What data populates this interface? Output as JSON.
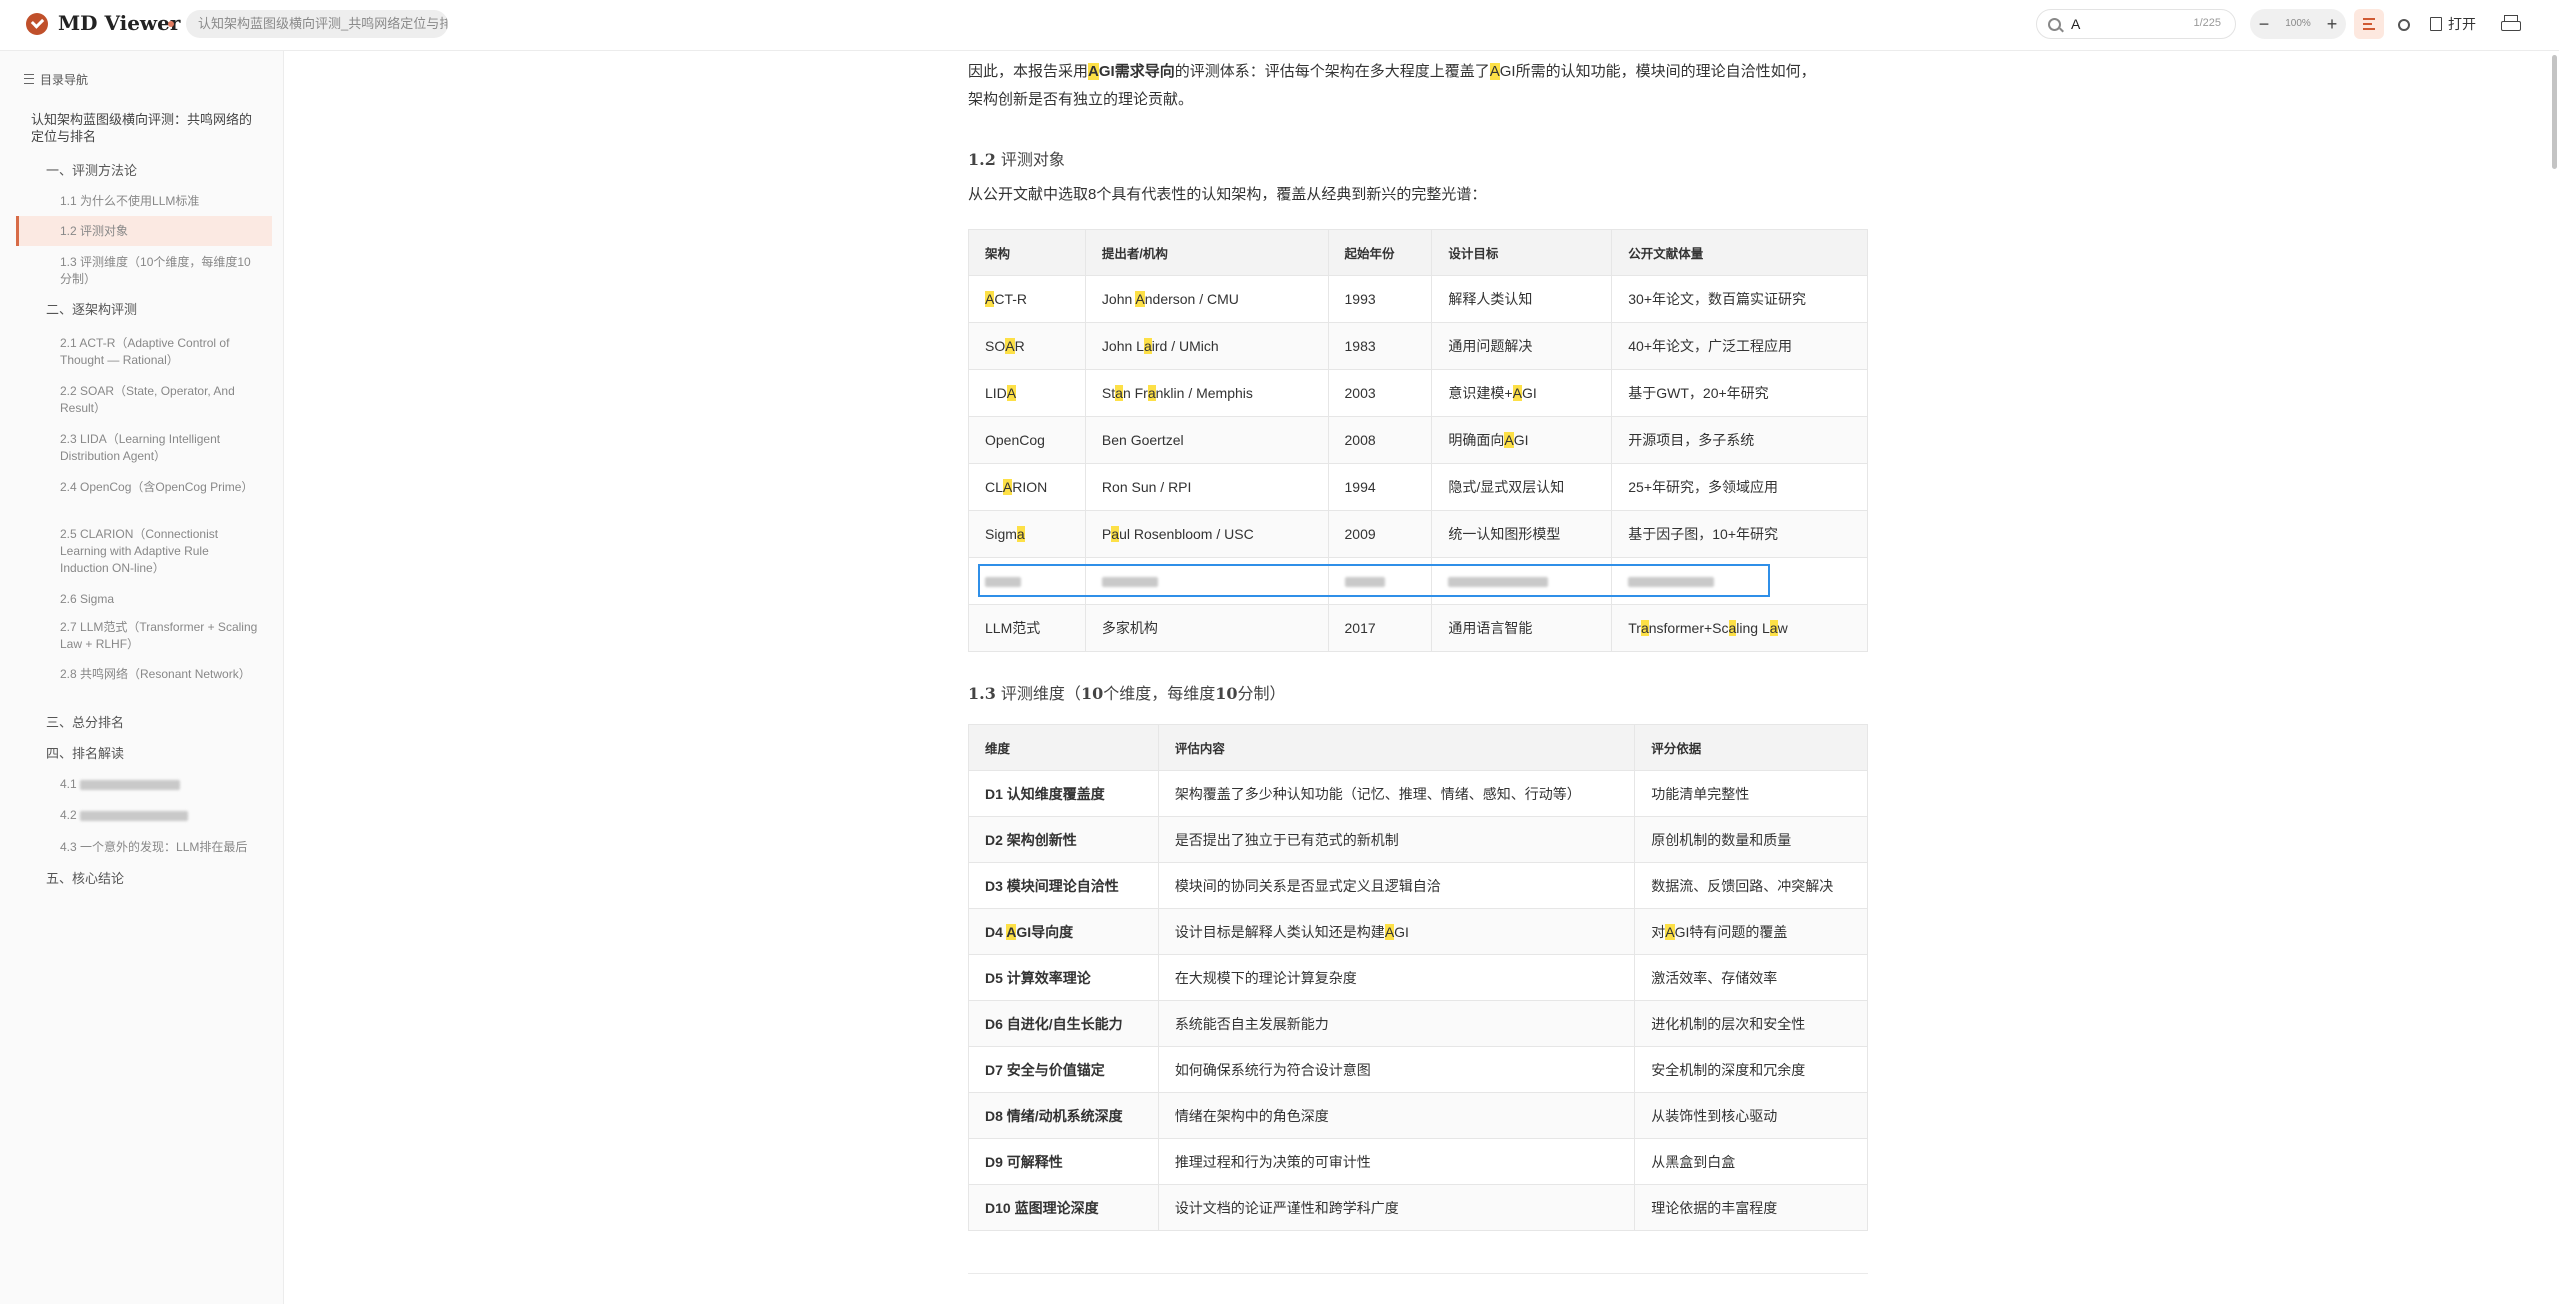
{
  "header": {
    "app_title": "MD Viewer",
    "file_name": "认知架构蓝图级横向评测_共鸣网络定位与排...",
    "search": {
      "value": "A",
      "count": "1/225"
    },
    "zoom": {
      "minus": "−",
      "value": "100%",
      "plus": "+"
    },
    "open_label": "打开",
    "accent_color": "#d05a33"
  },
  "sidebar": {
    "title": "目录导航",
    "items": [
      {
        "label": "认知架构蓝图级横向评测：共鸣网络的定位与排名"
      },
      {
        "label": "一、评测方法论"
      },
      {
        "label": "1.1 为什么不使用LLM标准"
      },
      {
        "label": "1.2 评测对象"
      },
      {
        "label": "1.3 评测维度（10个维度，每维度10分制）"
      },
      {
        "label": "二、逐架构评测"
      },
      {
        "label": "2.1 ACT-R（Adaptive Control of Thought — Rational）"
      },
      {
        "label": "2.2 SOAR（State, Operator, And Result）"
      },
      {
        "label": "2.3 LIDA（Learning Intelligent Distribution Agent）"
      },
      {
        "label": "2.4 OpenCog（含OpenCog Prime）"
      },
      {
        "label": "2.5 CLARION（Connectionist Learning with Adaptive Rule Induction ON-line）"
      },
      {
        "label": "2.6 Sigma"
      },
      {
        "label": "2.7 LLM范式（Transformer + Scaling Law + RLHF）"
      },
      {
        "label": "2.8 共鸣网络（Resonant Network）"
      },
      {
        "label": "三、总分排名"
      },
      {
        "label": "四、排名解读"
      },
      {
        "label": "4.1"
      },
      {
        "label": "4.2"
      },
      {
        "label": "4.3 一个意外的发现：LLM排在最后"
      },
      {
        "label": "五、核心结论"
      }
    ]
  },
  "content": {
    "intro": {
      "p1": "因此，本报告采用",
      "p2": "A",
      "p3": "GI需求导向",
      "p4": "的评测体系：评估每个架构在多大程度上覆盖了",
      "p5": "A",
      "p6": "GI所需的认知功能，模块间的理论自洽性如何，",
      "p7": "架构创新是否有独立的理论贡献。"
    },
    "s12": {
      "heading_num": "1.2",
      "heading_text": " 评测对象",
      "desc": "从公开文献中选取8个具有代表性的认知架构，覆盖从经典到新兴的完整光谱：",
      "headers": [
        "架构",
        "提出者/机构",
        "起始年份",
        "设计目标",
        "公开文献体量"
      ],
      "rows": [
        [
          "ACT-R",
          "John Anderson / CMU",
          "1993",
          "解释人类认知",
          "30+年论文，数百篇实证研究"
        ],
        [
          "SOAR",
          "John Laird / UMich",
          "1983",
          "通用问题解决",
          "40+年论文，广泛工程应用"
        ],
        [
          "LIDA",
          "Stan Franklin / Memphis",
          "2003",
          "意识建模+AGI",
          "基于GWT，20+年研究"
        ],
        [
          "OpenCog",
          "Ben Goertzel",
          "2008",
          "明确面向AGI",
          "开源项目，多子系统"
        ],
        [
          "CLARION",
          "Ron Sun / RPI",
          "1994",
          "隐式/显式双层认知",
          "25+年研究，多领域应用"
        ],
        [
          "Sigma",
          "Paul Rosenbloom / USC",
          "2009",
          "统一认知图形模型",
          "基于因子图，10+年研究"
        ],
        [
          "",
          "",
          "",
          "",
          ""
        ],
        [
          "LLM范式",
          "多家机构",
          "2017",
          "通用语言智能",
          "Transformer+Scaling Law"
        ]
      ]
    },
    "s13": {
      "heading_num": "1.3",
      "heading_text": " 评测维度（",
      "heading_n1": "10",
      "heading_mid": "个维度，每维度",
      "heading_n2": "10",
      "heading_end": "分制）",
      "headers": [
        "维度",
        "评估内容",
        "评分依据"
      ],
      "rows": [
        [
          "D1 认知维度覆盖度",
          "架构覆盖了多少种认知功能（记忆、推理、情绪、感知、行动等）",
          "功能清单完整性"
        ],
        [
          "D2 架构创新性",
          "是否提出了独立于已有范式的新机制",
          "原创机制的数量和质量"
        ],
        [
          "D3 模块间理论自洽性",
          "模块间的协同关系是否显式定义且逻辑自洽",
          "数据流、反馈回路、冲突解决"
        ],
        [
          "D4 AGI导向度",
          "设计目标是解释人类认知还是构建AGI",
          "对AGI特有问题的覆盖"
        ],
        [
          "D5 计算效率理论",
          "在大规模下的理论计算复杂度",
          "激活效率、存储效率"
        ],
        [
          "D6 自进化/自生长能力",
          "系统能否自主发展新能力",
          "进化机制的层次和安全性"
        ],
        [
          "D7 安全与价值锚定",
          "如何确保系统行为符合设计意图",
          "安全机制的深度和冗余度"
        ],
        [
          "D8 情绪/动机系统深度",
          "情绪在架构中的角色深度",
          "从装饰性到核心驱动"
        ],
        [
          "D9 可解释性",
          "推理过程和行为决策的可审计性",
          "从黑盒到白盒"
        ],
        [
          "D10 蓝图理论深度",
          "设计文档的论证严谨性和跨学科广度",
          "理论依据的丰富程度"
        ]
      ]
    }
  }
}
